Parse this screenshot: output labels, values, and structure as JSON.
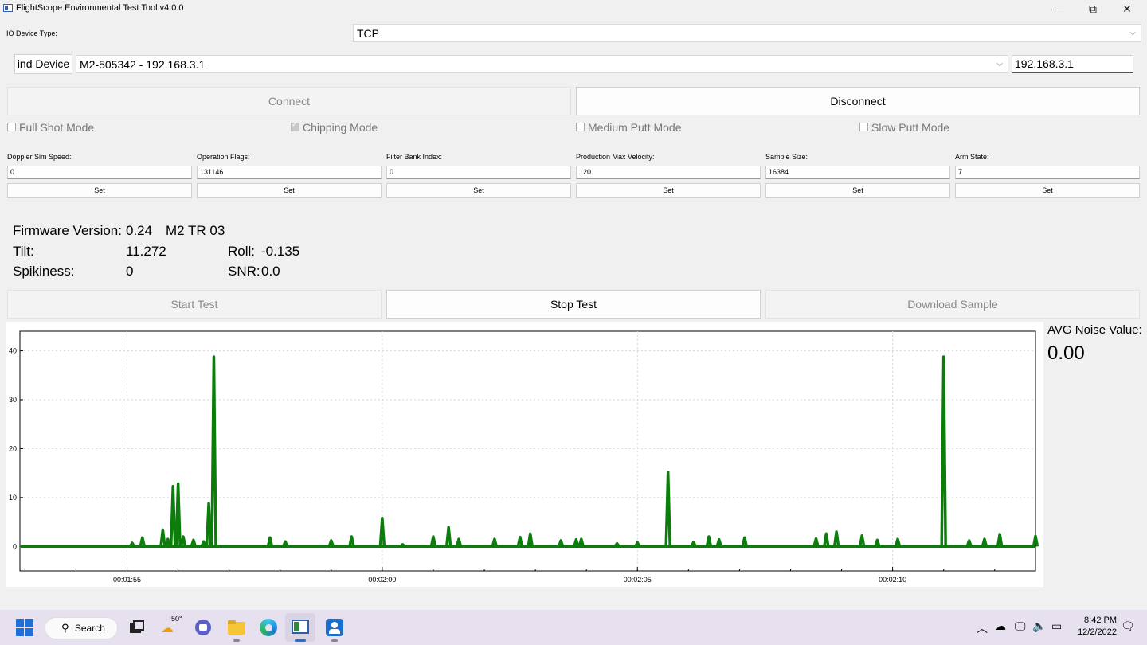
{
  "window": {
    "title": "FlightScope Environmental Test Tool v4.0.0",
    "minimize": "—",
    "maximize": "⧉",
    "close": "✕"
  },
  "io": {
    "label": "IO Device Type:",
    "value": "TCP"
  },
  "device": {
    "find_button": "ind Device",
    "selected": "M2-505342 - 192.168.3.1",
    "ip": "192.168.3.1"
  },
  "connection": {
    "connect": "Connect",
    "disconnect": "Disconnect"
  },
  "modes": [
    {
      "label": "Full Shot Mode",
      "checked": false
    },
    {
      "label": "Chipping Mode",
      "checked": true
    },
    {
      "label": "Medium Putt Mode",
      "checked": false
    },
    {
      "label": "Slow Putt Mode",
      "checked": false
    }
  ],
  "params": [
    {
      "label": "Doppler Sim Speed:",
      "value": "0",
      "set": "Set"
    },
    {
      "label": "Operation Flags:",
      "value": "131146",
      "set": "Set"
    },
    {
      "label": "Filter Bank Index:",
      "value": "0",
      "set": "Set"
    },
    {
      "label": "Production Max Velocity:",
      "value": "120",
      "set": "Set"
    },
    {
      "label": "Sample Size:",
      "value": "16384",
      "set": "Set"
    },
    {
      "label": "Arm State:",
      "value": "7",
      "set": "Set"
    }
  ],
  "info": {
    "firmware_label": "Firmware Version:",
    "firmware_value": "0.24",
    "model": "M2 TR 03",
    "tilt_label": "Tilt:",
    "tilt_value": "11.272",
    "roll_label": "Roll:",
    "roll_value": "-0.135",
    "spikiness_label": "Spikiness:",
    "spikiness_value": "0",
    "snr_label": "SNR:",
    "snr_value": "0.0"
  },
  "test": {
    "start": "Start Test",
    "stop": "Stop Test",
    "download": "Download Sample"
  },
  "avg": {
    "label": "AVG Noise Value:",
    "value": "0.00"
  },
  "chart_data": {
    "type": "line",
    "series_color": "#0a7d0a",
    "xlabel": "",
    "ylabel": "",
    "x_start": "00:01:52.9",
    "x_end": "00:02:12.8",
    "x_ticks": [
      "00:01:55",
      "00:02:00",
      "00:02:05",
      "00:02:10"
    ],
    "y_ticks": [
      0,
      10,
      20,
      30,
      40
    ],
    "ylim": [
      -5,
      44
    ],
    "grid": true,
    "spikes": [
      {
        "t": "00:01:55.1",
        "v": 0.7
      },
      {
        "t": "00:01:55.3",
        "v": 1.8
      },
      {
        "t": "00:01:55.7",
        "v": 3.4
      },
      {
        "t": "00:01:55.8",
        "v": 1.5
      },
      {
        "t": "00:01:55.9",
        "v": 12.3
      },
      {
        "t": "00:01:56.0",
        "v": 12.8
      },
      {
        "t": "00:01:56.1",
        "v": 2.0
      },
      {
        "t": "00:01:56.3",
        "v": 1.3
      },
      {
        "t": "00:01:56.5",
        "v": 1.0
      },
      {
        "t": "00:01:56.6",
        "v": 8.8
      },
      {
        "t": "00:01:56.7",
        "v": 38.8
      },
      {
        "t": "00:01:57.8",
        "v": 1.8
      },
      {
        "t": "00:01:58.1",
        "v": 1.0
      },
      {
        "t": "00:01:59.0",
        "v": 1.2
      },
      {
        "t": "00:01:59.4",
        "v": 2.0
      },
      {
        "t": "00:02:00.0",
        "v": 5.8
      },
      {
        "t": "00:02:00.4",
        "v": 0.4
      },
      {
        "t": "00:02:01.0",
        "v": 2.0
      },
      {
        "t": "00:02:01.3",
        "v": 3.9
      },
      {
        "t": "00:02:01.5",
        "v": 1.5
      },
      {
        "t": "00:02:02.2",
        "v": 1.5
      },
      {
        "t": "00:02:02.7",
        "v": 1.9
      },
      {
        "t": "00:02:02.9",
        "v": 2.6
      },
      {
        "t": "00:02:03.5",
        "v": 1.2
      },
      {
        "t": "00:02:03.8",
        "v": 1.4
      },
      {
        "t": "00:02:03.9",
        "v": 1.5
      },
      {
        "t": "00:02:04.6",
        "v": 0.6
      },
      {
        "t": "00:02:05.0",
        "v": 0.8
      },
      {
        "t": "00:02:05.6",
        "v": 15.2
      },
      {
        "t": "00:02:06.1",
        "v": 0.9
      },
      {
        "t": "00:02:06.4",
        "v": 2.0
      },
      {
        "t": "00:02:06.6",
        "v": 1.4
      },
      {
        "t": "00:02:07.1",
        "v": 1.8
      },
      {
        "t": "00:02:08.5",
        "v": 1.6
      },
      {
        "t": "00:02:08.7",
        "v": 2.6
      },
      {
        "t": "00:02:08.9",
        "v": 3.0
      },
      {
        "t": "00:02:09.4",
        "v": 2.2
      },
      {
        "t": "00:02:09.7",
        "v": 1.3
      },
      {
        "t": "00:02:10.1",
        "v": 1.5
      },
      {
        "t": "00:02:11.0",
        "v": 38.8
      },
      {
        "t": "00:02:11.5",
        "v": 1.2
      },
      {
        "t": "00:02:11.8",
        "v": 1.5
      },
      {
        "t": "00:02:12.1",
        "v": 2.5
      },
      {
        "t": "00:02:12.8",
        "v": 2.1
      }
    ]
  },
  "taskbar": {
    "search": "Search",
    "weather": "50°",
    "time": "8:42 PM",
    "date": "12/2/2022"
  }
}
